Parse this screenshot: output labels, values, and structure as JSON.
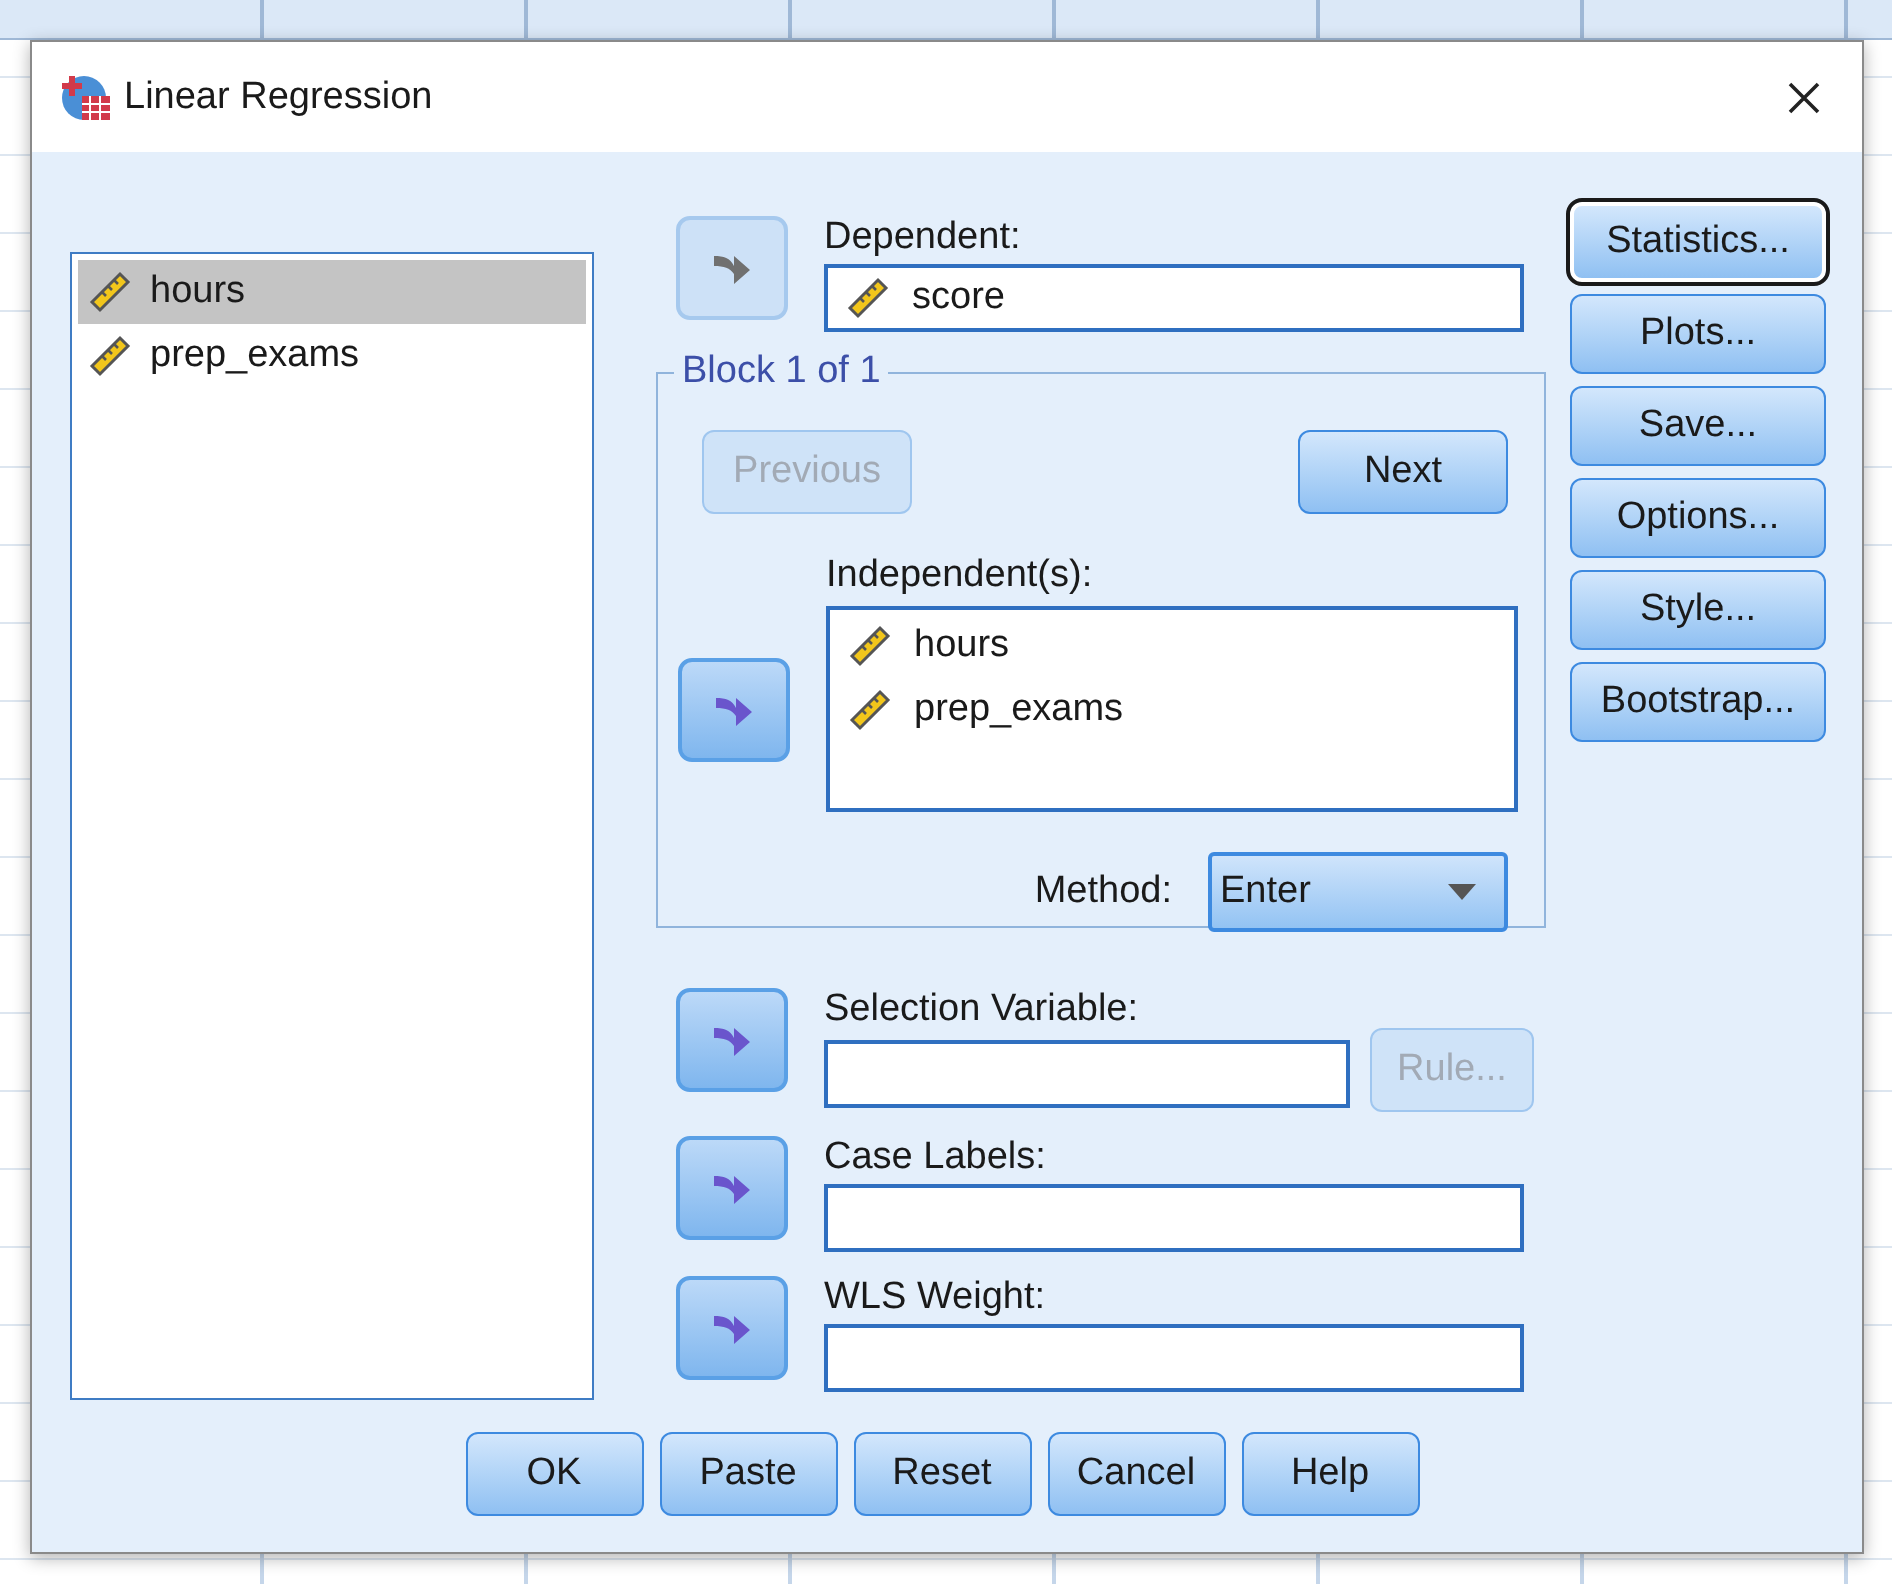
{
  "window": {
    "title": "Linear Regression"
  },
  "variables": [
    {
      "name": "hours",
      "kind": "scale",
      "selected": true
    },
    {
      "name": "prep_exams",
      "kind": "scale",
      "selected": false
    }
  ],
  "dependent": {
    "label": "Dependent:",
    "arrow_disabled": true,
    "variables": [
      {
        "name": "score",
        "kind": "scale"
      }
    ]
  },
  "block": {
    "title": "Block 1 of 1",
    "buttons": [
      {
        "label": "Previous",
        "disabled": true
      },
      {
        "label": "Next",
        "disabled": false
      }
    ],
    "independent": {
      "label": "Independent(s):",
      "arrow_disabled": false,
      "variables": [
        {
          "name": "hours",
          "kind": "scale"
        },
        {
          "name": "prep_exams",
          "kind": "scale"
        }
      ]
    },
    "method": {
      "label": "Method:",
      "value": "Enter"
    }
  },
  "selection": {
    "label": "Selection Variable:",
    "arrow_disabled": false,
    "rule": {
      "label": "Rule...",
      "disabled": true
    }
  },
  "case_labels": {
    "label": "Case Labels:",
    "arrow_disabled": false
  },
  "wls_weight": {
    "label": "WLS Weight:",
    "arrow_disabled": false
  },
  "side_buttons": [
    {
      "label": "Statistics...",
      "focused": true
    },
    {
      "label": "Plots...",
      "focused": false
    },
    {
      "label": "Save...",
      "focused": false
    },
    {
      "label": "Options...",
      "focused": false
    },
    {
      "label": "Style...",
      "focused": false
    },
    {
      "label": "Bootstrap...",
      "focused": false
    }
  ],
  "footer_buttons": [
    "OK",
    "Paste",
    "Reset",
    "Cancel",
    "Help"
  ]
}
